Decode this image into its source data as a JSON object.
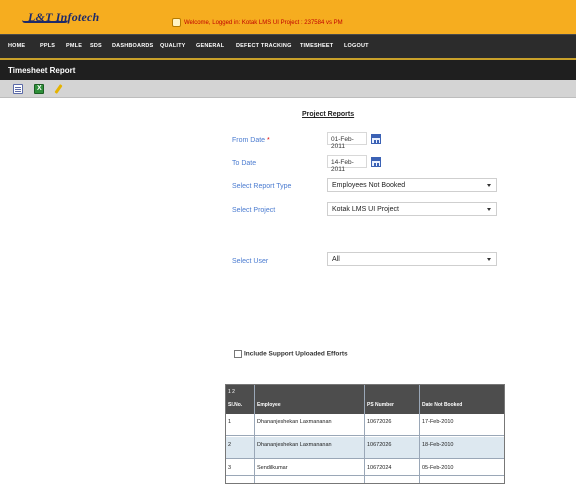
{
  "app": {
    "logo_text": "L&T Infotech",
    "login_message": "Welcome, Logged in: Kotak LMS UI Project : 237584 vs PM"
  },
  "nav": {
    "items": [
      "HOME",
      "PPLS",
      "PMLE",
      "SDS",
      "DASHBOARDS",
      "QUALITY",
      "GENERAL",
      "DEFECT TRACKING",
      "TIMESHEET",
      "LOGOUT"
    ]
  },
  "page": {
    "title": "Timesheet Report"
  },
  "toolbar": {
    "icons": [
      "list-icon",
      "excel-icon",
      "edit-icon"
    ]
  },
  "form": {
    "section_title": "Project Reports",
    "from_date_label": "From Date",
    "required_marker": "*",
    "from_date_value": "01-Feb-2011",
    "to_date_label": "To Date",
    "to_date_value": "14-Feb-2011",
    "report_type_label": "Select Report Type",
    "report_type_value": "Employees Not Booked",
    "project_label": "Select Project",
    "project_value": "Kotak LMS UI Project",
    "user_label": "Select User",
    "user_value": "All",
    "support_checkbox_label": "Include Support Uploaded Efforts"
  },
  "grid": {
    "pager": "1 2",
    "headers": [
      "Sl.No.",
      "Employee",
      "PS Number",
      "Date Not Booked"
    ],
    "rows": [
      {
        "slno": "1",
        "employee": "Dhananjeshekan Laxmananan",
        "ps": "10672026",
        "date": "17-Feb-2010"
      },
      {
        "slno": "2",
        "employee": "Dhananjeshekan Laxmananan",
        "ps": "10672026",
        "date": "18-Feb-2010"
      },
      {
        "slno": "3",
        "employee": "Sendilkumar",
        "ps": "10672024",
        "date": "05-Feb-2010"
      }
    ]
  }
}
